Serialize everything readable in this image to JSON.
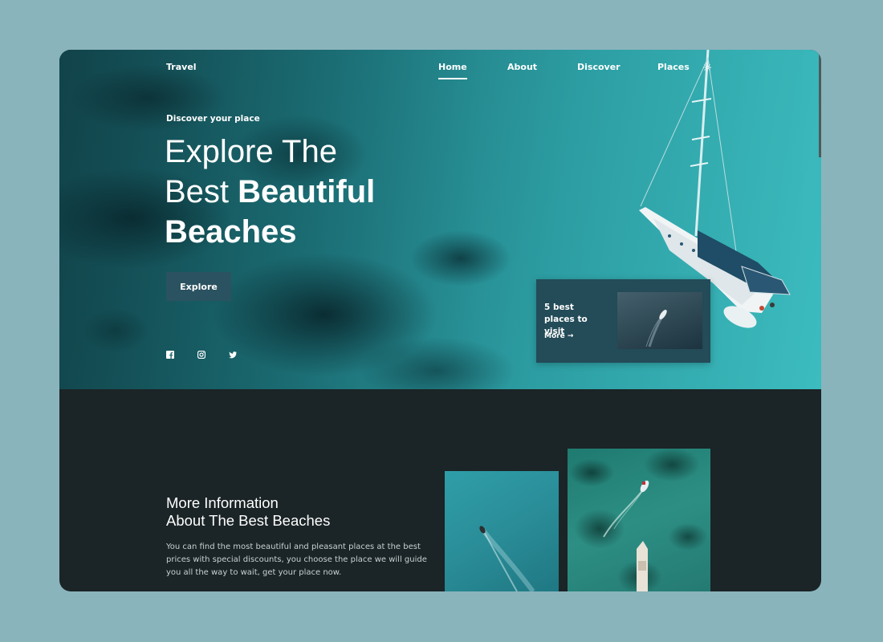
{
  "nav": {
    "brand": "Travel",
    "links": [
      "Home",
      "About",
      "Discover",
      "Places"
    ],
    "active": "Home",
    "theme_icon": "sun-icon"
  },
  "hero": {
    "kicker": "Discover your place",
    "headline_line1": "Explore The",
    "headline_line2_light": "Best",
    "headline_line2_bold": "Beautiful",
    "headline_line3_bold": "Beaches",
    "explore_button": "Explore",
    "social_icons": [
      "facebook-icon",
      "instagram-icon",
      "twitter-icon"
    ]
  },
  "card": {
    "title": "5 best places to visit",
    "more_label": "More",
    "more_icon": "arrow-right-icon"
  },
  "info": {
    "title_line1": "More Information",
    "title_line2": "About The Best Beaches",
    "body": "You can find the most beautiful and pleasant places at the best prices with special discounts, you choose the place we will guide you all the way to wait, get your place now."
  },
  "colors": {
    "page_background": "#8ab4bc",
    "dark_section": "#1b2426",
    "button": "#2b5260",
    "card": "#234b58",
    "water": "#2ea3a8"
  }
}
